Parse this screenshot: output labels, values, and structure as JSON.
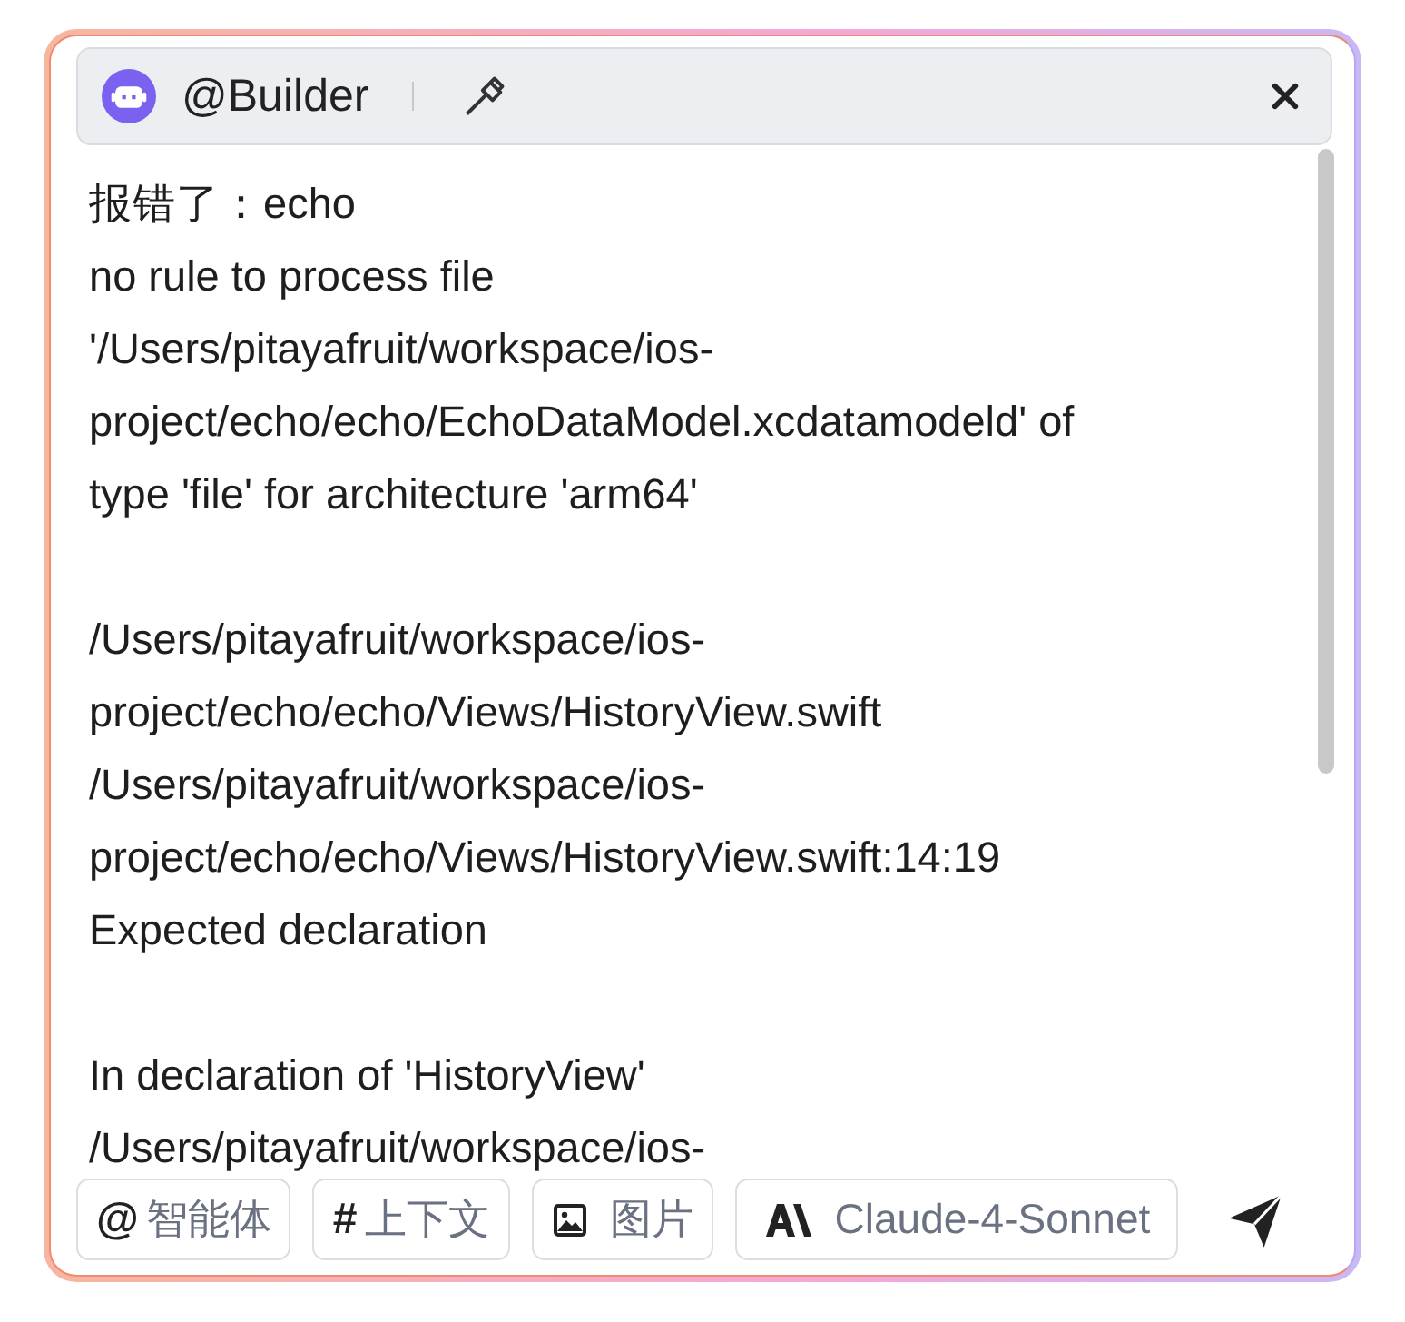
{
  "header": {
    "agent": "@Builder"
  },
  "message": [
    [
      "报错了：echo",
      "no rule to process file",
      "'/Users/pitayafruit/workspace/ios-",
      "project/echo/echo/EchoDataModel.xcdatamodeld' of",
      "type 'file' for architecture 'arm64'"
    ],
    [
      "/Users/pitayafruit/workspace/ios-",
      "project/echo/echo/Views/HistoryView.swift",
      "/Users/pitayafruit/workspace/ios-",
      "project/echo/echo/Views/HistoryView.swift:14:19",
      "Expected declaration"
    ],
    [
      "In declaration of 'HistoryView'",
      "/Users/pitayafruit/workspace/ios-"
    ]
  ],
  "toolbar": [
    {
      "kind": "glyph",
      "icon": "@",
      "label": "智能体"
    },
    {
      "kind": "glyph",
      "icon": "#",
      "label": "上下文"
    },
    {
      "kind": "image",
      "label": "图片"
    },
    {
      "kind": "model",
      "label": "Claude-4-Sonnet"
    }
  ]
}
